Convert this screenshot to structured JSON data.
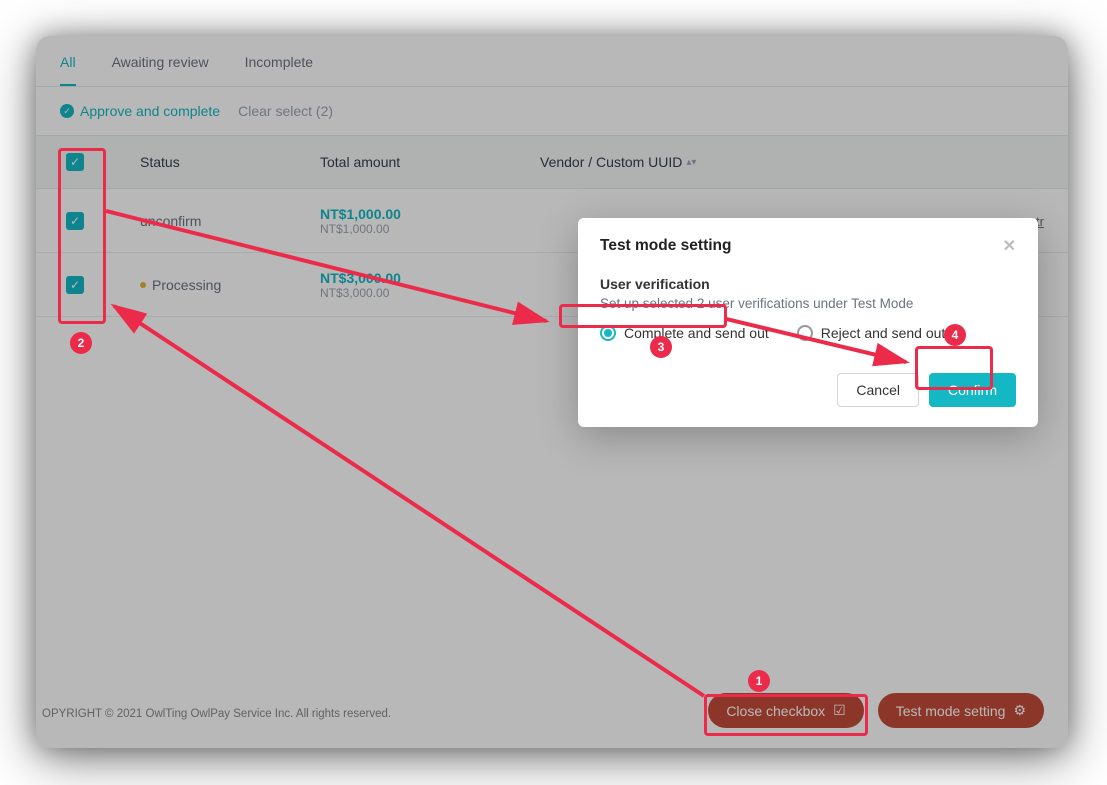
{
  "tabs": {
    "all": "All",
    "awaiting": "Awaiting review",
    "incomplete": "Incomplete",
    "active": "all"
  },
  "actionbar": {
    "approve": "Approve and complete",
    "clear": "Clear select (2)"
  },
  "table": {
    "headers": {
      "status": "Status",
      "amount": "Total amount",
      "vendor": "Vendor / Custom UUID"
    },
    "rows": [
      {
        "status_text": "unconfirm",
        "dot": false,
        "amount_main": "NT$1,000.00",
        "amount_sub": "NT$1,000.00",
        "link": "otr"
      },
      {
        "status_text": "Processing",
        "dot": true,
        "amount_main": "NT$3,000.00",
        "amount_sub": "NT$3,000.00",
        "link": ""
      }
    ]
  },
  "footer": {
    "copyright": "OPYRIGHT © 2021 OwlTing OwlPay Service Inc. All rights reserved."
  },
  "bottom_buttons": {
    "close_checkbox": "Close checkbox",
    "test_mode": "Test mode setting"
  },
  "modal": {
    "title": "Test mode setting",
    "section_title": "User verification",
    "desc": "Set up selected 2 user verifications under Test Mode",
    "option_complete": "Complete and send out",
    "option_reject": "Reject and send out",
    "cancel": "Cancel",
    "confirm": "Confirm"
  },
  "annotations": {
    "one": "1",
    "two": "2",
    "three": "3",
    "four": "4"
  }
}
